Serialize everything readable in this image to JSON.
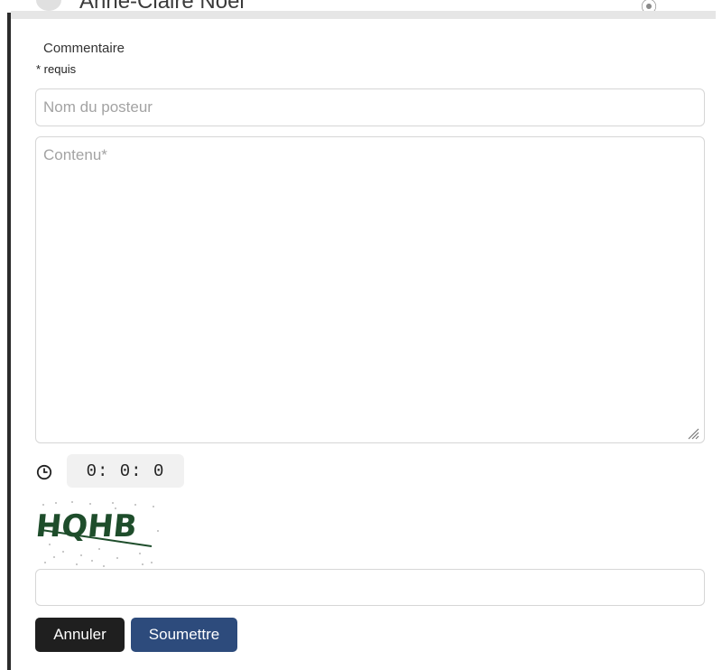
{
  "previous_comment": {
    "author": "Anne-Claire Noël"
  },
  "form": {
    "heading": "Commentaire",
    "required_note": "* requis",
    "name_placeholder": "Nom du posteur",
    "name_value": "",
    "content_placeholder": "Contenu*",
    "content_value": "",
    "timer": "0: 0: 0",
    "captcha_text": "HQHB",
    "captcha_value": ""
  },
  "buttons": {
    "cancel": "Annuler",
    "submit": "Soumettre"
  },
  "colors": {
    "submit_button": "#2d4b7c",
    "cancel_button": "#1f1f1f",
    "captcha_text": "#1e4d2b"
  }
}
